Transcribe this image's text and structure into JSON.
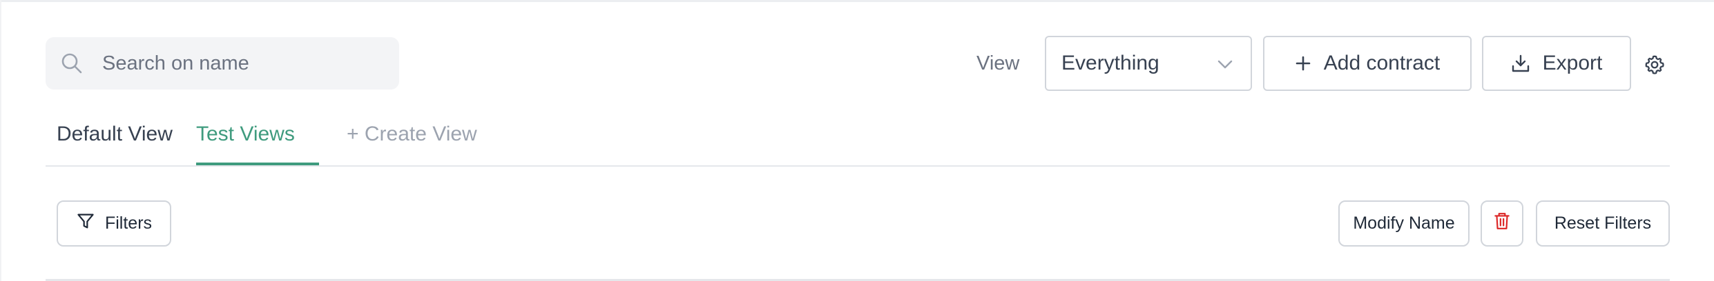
{
  "search": {
    "placeholder": "Search on name",
    "value": "",
    "icon": "search-icon"
  },
  "view": {
    "label": "View",
    "selected": "Everything",
    "icon": "chevron-down-icon"
  },
  "toolbar": {
    "add_label": "Add contract",
    "add_icon": "plus-icon",
    "export_label": "Export",
    "export_icon": "download-icon",
    "settings_icon": "gear-icon"
  },
  "tabs": [
    {
      "label": "Default View",
      "active": false
    },
    {
      "label": "Test Views",
      "active": true
    },
    {
      "label": "+ Create View",
      "active": false
    }
  ],
  "filter_bar": {
    "filters_label": "Filters",
    "filters_icon": "funnel-icon",
    "modify_label": "Modify Name",
    "delete_icon": "trash-icon",
    "reset_label": "Reset Filters"
  },
  "colors": {
    "accent": "#3f9b7e",
    "danger": "#dc2626",
    "border": "#d1d5db",
    "search_bg": "#f3f4f6"
  }
}
